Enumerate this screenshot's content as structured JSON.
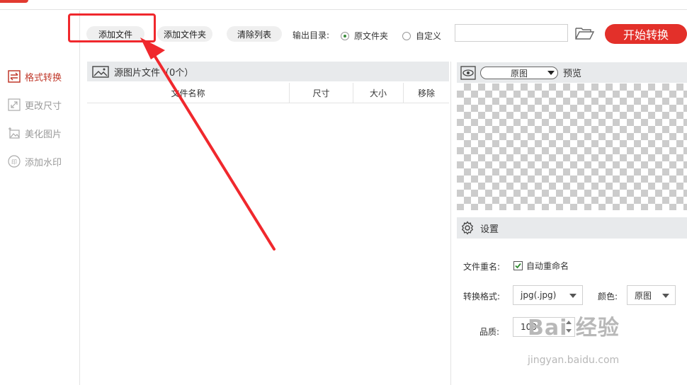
{
  "sidebar": {
    "items": [
      {
        "label": "格式转换",
        "icon": "swap-arrows-icon",
        "active": true
      },
      {
        "label": "更改尺寸",
        "icon": "resize-icon",
        "active": false
      },
      {
        "label": "美化图片",
        "icon": "beautify-image-icon",
        "active": false
      },
      {
        "label": "添加水印",
        "icon": "stamp-icon",
        "active": false
      }
    ]
  },
  "toolbar": {
    "add_file": "添加文件",
    "add_folder": "添加文件夹",
    "clear_list": "清除列表",
    "output_dir_label": "输出目录:",
    "radio_original": "原文件夹",
    "radio_custom": "自定义",
    "selected_output": "原文件夹",
    "path_value": "",
    "start": "开始转换"
  },
  "files": {
    "header": "源图片文件（0个）",
    "columns": [
      "文件名称",
      "尺寸",
      "大小",
      "移除"
    ],
    "rows": []
  },
  "preview": {
    "mode": "原图",
    "title": "预览"
  },
  "settings": {
    "title": "设置",
    "rename_label": "文件重名:",
    "rename_option": "自动重命名",
    "rename_checked": true,
    "format_label": "转换格式:",
    "format_value": "jpg(.jpg)",
    "color_label": "颜色:",
    "color_value": "原图",
    "quality_label": "品质:",
    "quality_value": "100"
  },
  "watermark": {
    "main": "Bai 经验",
    "sub": "jingyan.baidu.com"
  },
  "colors": {
    "accent": "#e3302a",
    "annotation": "#f0282d",
    "active_sidebar": "#c0392b"
  }
}
